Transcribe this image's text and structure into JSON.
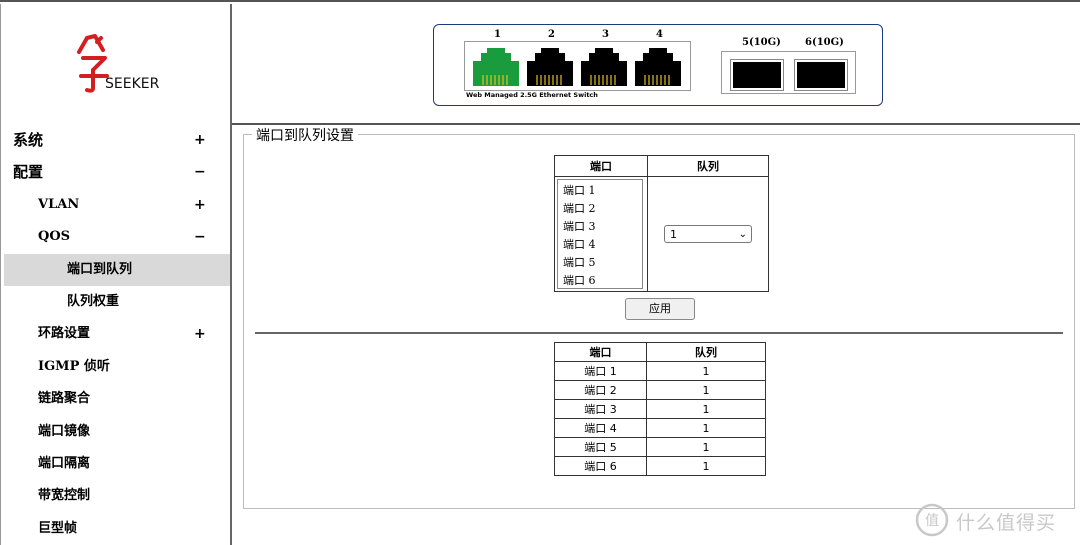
{
  "logo": {
    "text": "SEEKER",
    "color": "#d21f1f"
  },
  "sidebar": {
    "items": [
      {
        "label": "系统",
        "sign": "+",
        "level": 0
      },
      {
        "label": "配置",
        "sign": "−",
        "level": 0
      },
      {
        "label": "VLAN",
        "sign": "+",
        "level": 1
      },
      {
        "label": "QOS",
        "sign": "−",
        "level": 1
      },
      {
        "label": "端口到队列",
        "sign": "",
        "level": 2,
        "active": true
      },
      {
        "label": "队列权重",
        "sign": "",
        "level": 2
      },
      {
        "label": "环路设置",
        "sign": "+",
        "level": 1
      },
      {
        "label": "IGMP 侦听",
        "sign": "",
        "level": 1
      },
      {
        "label": "链路聚合",
        "sign": "",
        "level": 1
      },
      {
        "label": "端口镜像",
        "sign": "",
        "level": 1
      },
      {
        "label": "端口隔离",
        "sign": "",
        "level": 1
      },
      {
        "label": "带宽控制",
        "sign": "",
        "level": 1
      },
      {
        "label": "巨型帧",
        "sign": "",
        "level": 1
      }
    ]
  },
  "panel": {
    "ports": [
      {
        "num": "1",
        "status_color": "#1a9c3e"
      },
      {
        "num": "2",
        "status_color": "#000000"
      },
      {
        "num": "3",
        "status_color": "#000000"
      },
      {
        "num": "4",
        "status_color": "#000000"
      }
    ],
    "sfp": [
      {
        "num": "5(10G)"
      },
      {
        "num": "6(10G)"
      }
    ],
    "caption": "Web Managed 2.5G Ethernet Switch",
    "border_color": "#1c3a7a"
  },
  "main": {
    "legend": "端口到队列设置",
    "config_headers": {
      "port": "端口",
      "queue": "队列"
    },
    "port_list": [
      "端口 1",
      "端口 2",
      "端口 3",
      "端口 4",
      "端口 5",
      "端口 6"
    ],
    "queue_selected": "1",
    "apply_label": "应用",
    "result_headers": {
      "port": "端口",
      "queue": "队列"
    },
    "result_rows": [
      {
        "port": "端口 1",
        "queue": "1"
      },
      {
        "port": "端口 2",
        "queue": "1"
      },
      {
        "port": "端口 3",
        "queue": "1"
      },
      {
        "port": "端口 4",
        "queue": "1"
      },
      {
        "port": "端口 5",
        "queue": "1"
      },
      {
        "port": "端口 6",
        "queue": "1"
      }
    ]
  },
  "watermark": {
    "text": "什么值得买",
    "icon": "smile-badge-icon"
  }
}
